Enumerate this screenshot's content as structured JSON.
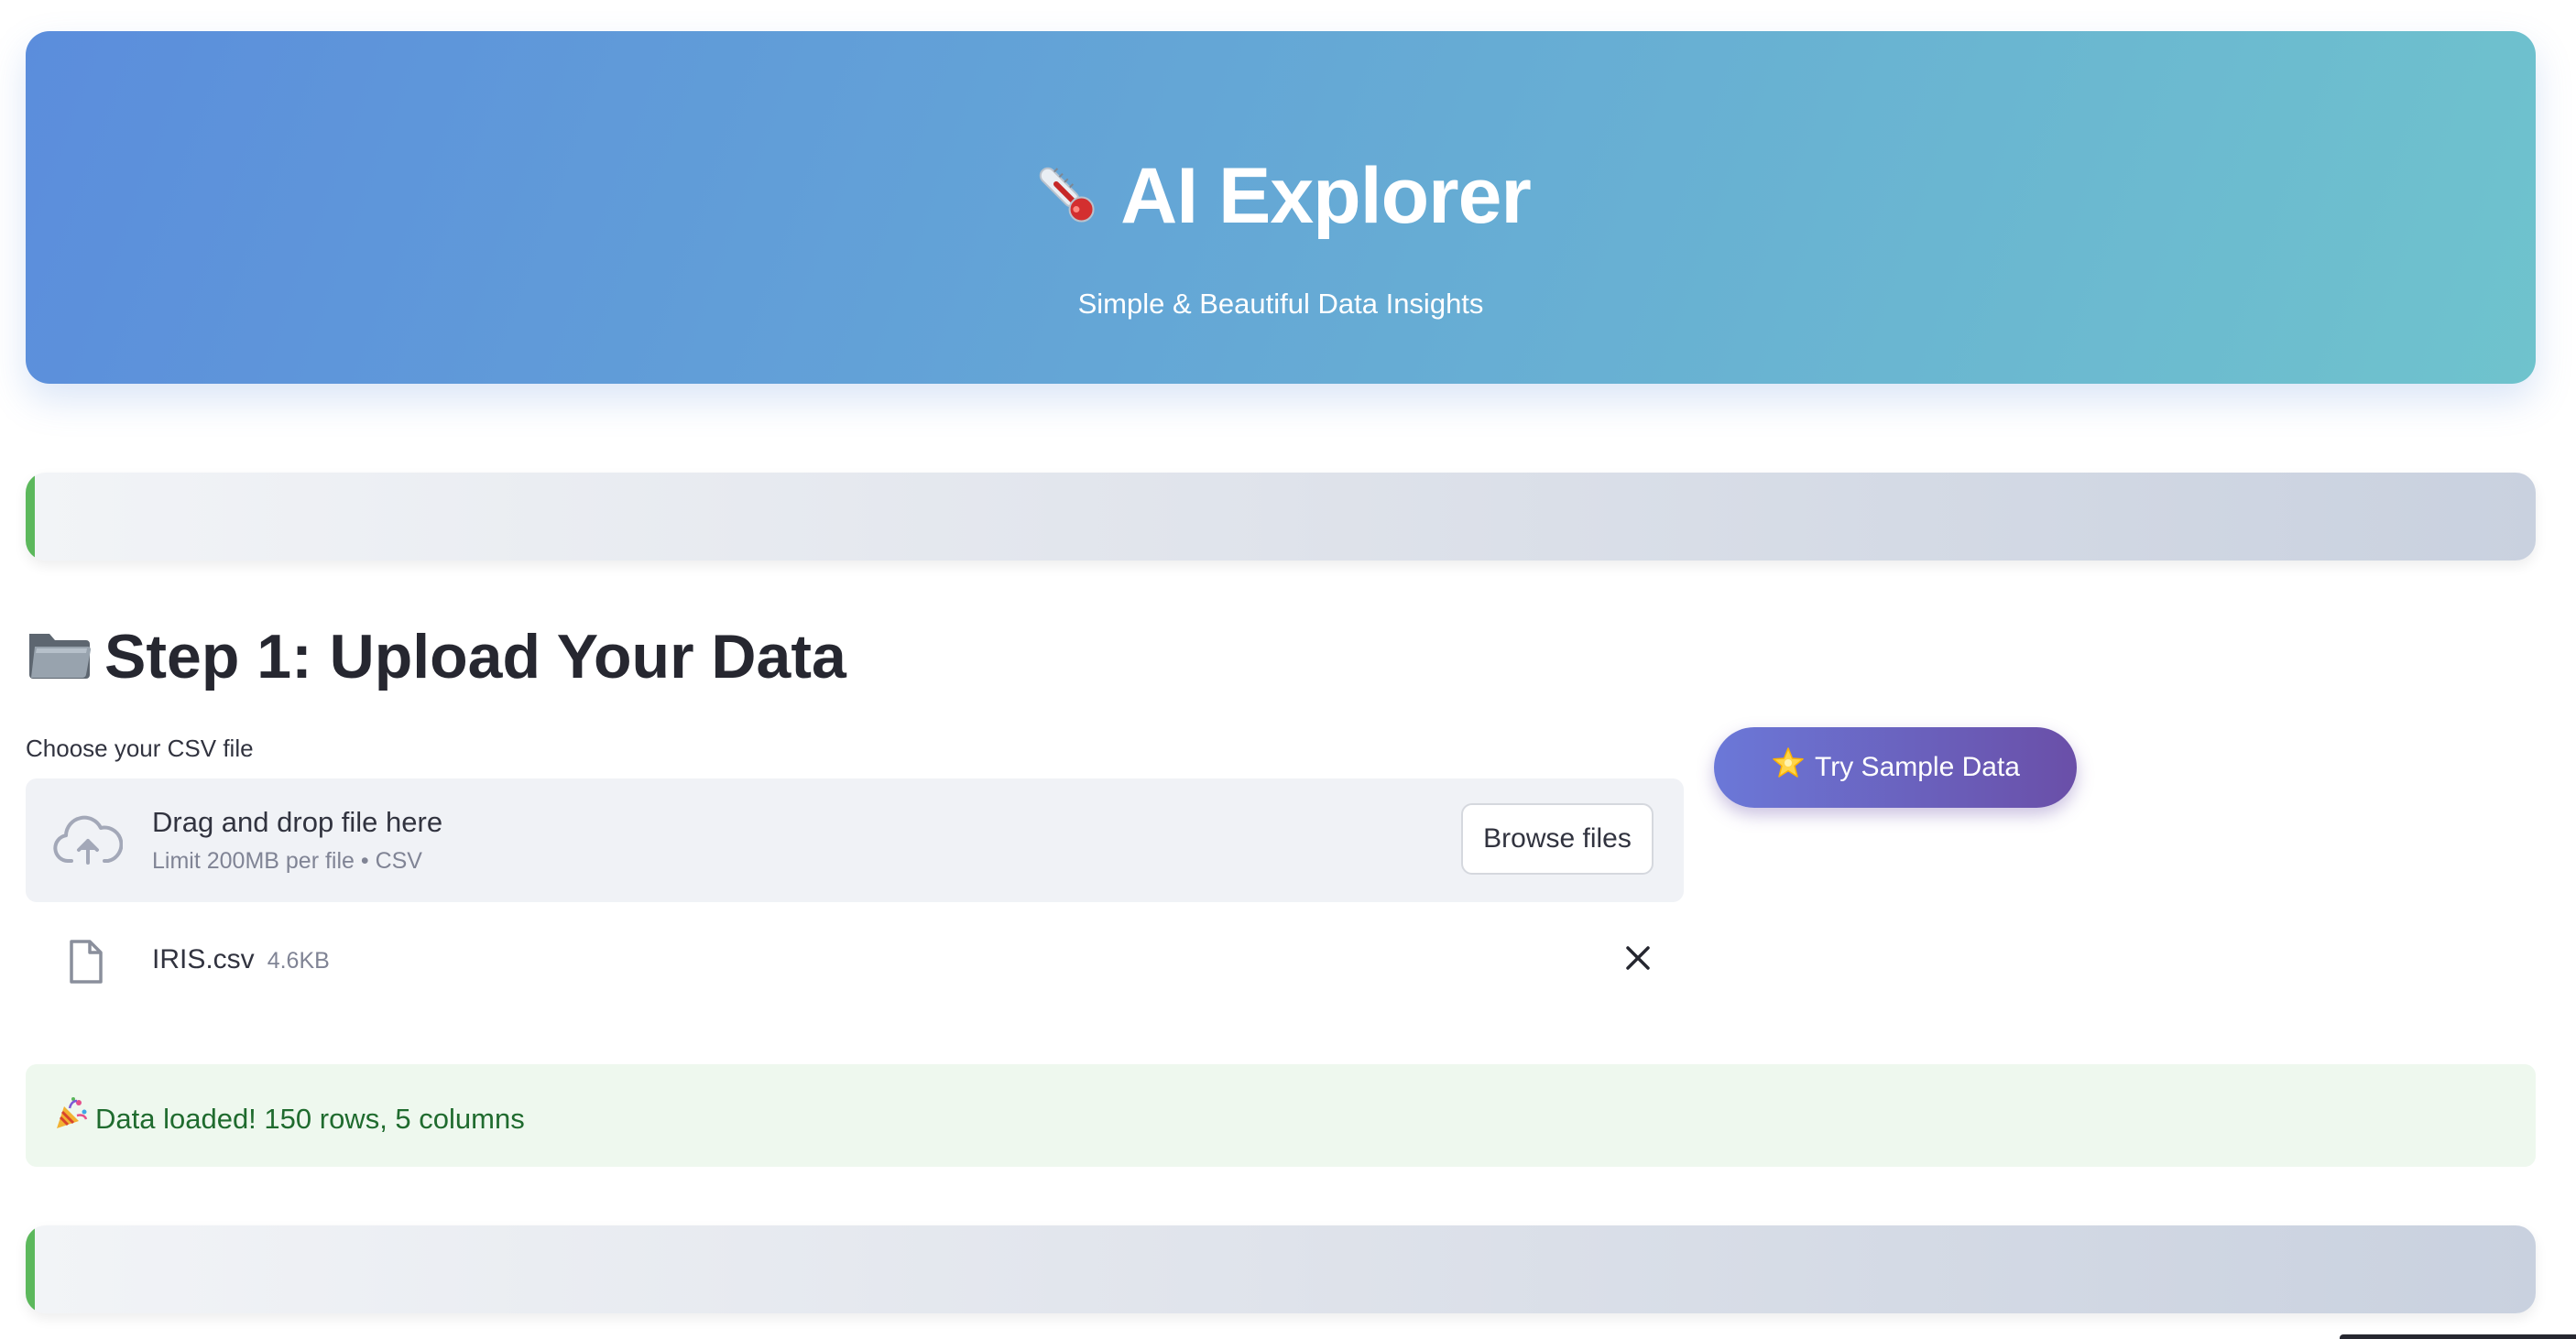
{
  "header": {
    "title": "AI Explorer",
    "subtitle": "Simple & Beautiful Data Insights",
    "icon": "thermometer-icon"
  },
  "step1": {
    "title": "Step 1: Upload Your Data",
    "icon": "folder-icon"
  },
  "uploader": {
    "label": "Choose your CSV file",
    "drop_text": "Drag and drop file here",
    "limit_text": "Limit 200MB per file • CSV",
    "browse_label": "Browse files",
    "icon": "cloud-upload-icon"
  },
  "uploaded_file": {
    "name": "IRIS.csv",
    "size": "4.6KB",
    "icon": "file-icon",
    "remove_icon": "close-icon"
  },
  "status": {
    "message": "Data loaded! 150 rows, 5 columns",
    "icon": "party-popper-icon",
    "color": "#1f6b2e",
    "background": "#eef8ee"
  },
  "sample_button": {
    "label": "Try Sample Data",
    "icon": "star-icon"
  },
  "theme": {
    "hero_gradient_start": "#5b8ddc",
    "hero_gradient_end": "#6fc3cd",
    "accent_green": "#5cb85c",
    "button_gradient_start": "#6b78d8",
    "button_gradient_end": "#6a4fa8"
  }
}
